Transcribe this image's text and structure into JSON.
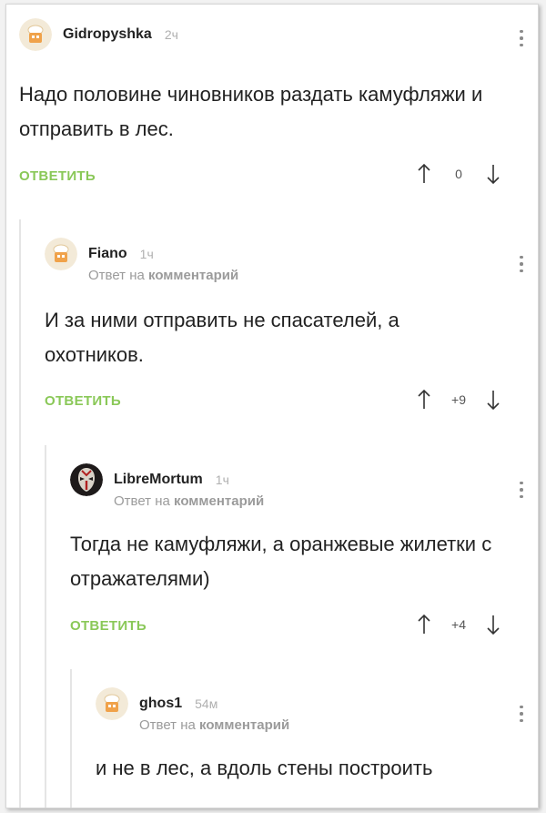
{
  "comments": [
    {
      "author": "Gidropyshka",
      "time": "2ч",
      "text": "Надо половине чиновников раздать камуфляжи и отправить в лес.",
      "reply_label": "ОТВЕТИТЬ",
      "score": "0",
      "avatar_icon": "default-avatar-icon"
    },
    {
      "author": "Fiano",
      "time": "1ч",
      "reply_prefix": "Ответ на",
      "reply_target": "комментарий",
      "text": "И за ними отправить не спасателей, а охотников.",
      "reply_label": "ОТВЕТИТЬ",
      "score": "+9",
      "avatar_icon": "default-avatar-icon"
    },
    {
      "author": "LibreMortum",
      "time": "1ч",
      "reply_prefix": "Ответ на",
      "reply_target": "комментарий",
      "text": "Тогда не камуфляжи, а оранжевые жилетки с отражателями)",
      "reply_label": "ОТВЕТИТЬ",
      "score": "+4",
      "avatar_icon": "masked-face-avatar-icon"
    },
    {
      "author": "ghos1",
      "time": "54м",
      "reply_prefix": "Ответ на",
      "reply_target": "комментарий",
      "text": "и не в лес, а вдоль стены построить",
      "avatar_icon": "default-avatar-icon"
    }
  ],
  "colors": {
    "accent_green": "#8ac858",
    "muted_text": "#9b9b9b",
    "thread_line": "#e5e5e5"
  }
}
